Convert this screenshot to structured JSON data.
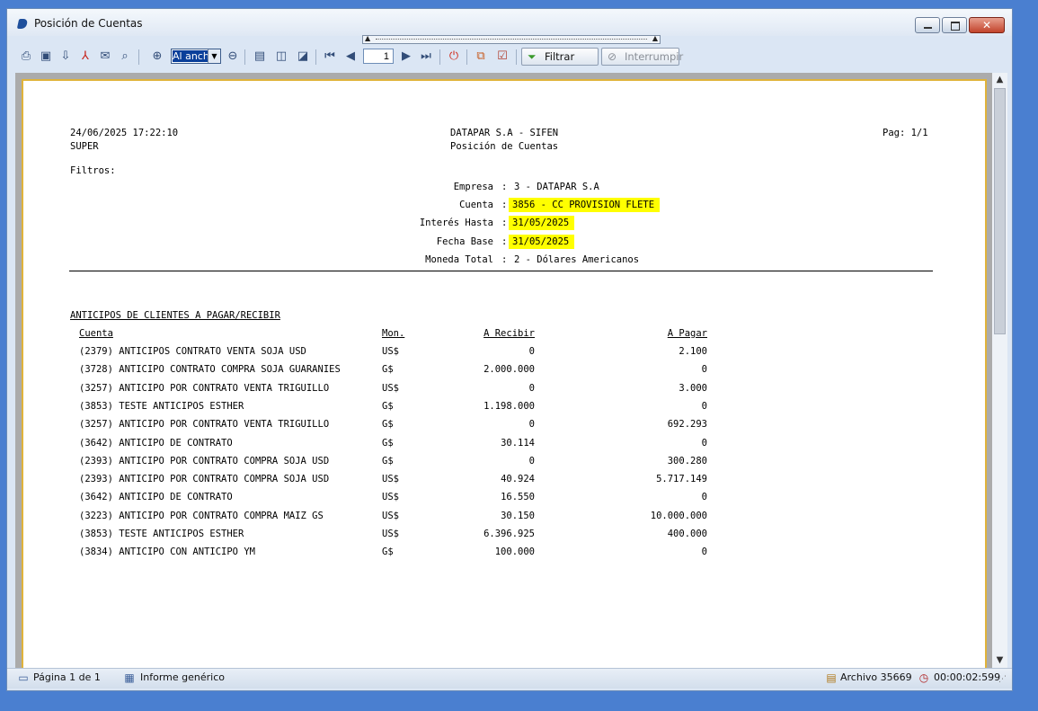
{
  "window": {
    "title": "Posición de Cuentas",
    "close_glyph": "✕"
  },
  "toolbar": {
    "zoom_value": "Al ancho",
    "page_number": "1",
    "filter_label": "Filtrar",
    "interrupt_label": "Interrumpir",
    "icons": [
      "print-icon",
      "save-icon",
      "export-icon",
      "pdf-icon",
      "mail-icon",
      "find-icon",
      "zoom-in-icon",
      "zoom-out-icon",
      "page-setup-icon",
      "single-page-icon",
      "page-zoom-icon",
      "first-page-icon",
      "prev-page-icon",
      "next-page-icon",
      "last-page-icon",
      "stop-icon",
      "copy-icon",
      "settings-icon",
      "filter-icon",
      "interrupt-icon"
    ]
  },
  "report": {
    "datetime": "24/06/2025 17:22:10",
    "user": "SUPER",
    "company_title": "DATAPAR S.A - SIFEN",
    "report_title": "Posición de Cuentas",
    "page": "Pag: 1/1",
    "filters_label": "Filtros:",
    "filters": [
      {
        "label": "Empresa",
        "value": "3 - DATAPAR S.A",
        "highlight": false
      },
      {
        "label": "Cuenta",
        "value": "3856 - CC PROVISION FLETE",
        "highlight": true
      },
      {
        "label": "Interés Hasta",
        "value": "31/05/2025",
        "highlight": true
      },
      {
        "label": "Fecha Base",
        "value": "31/05/2025",
        "highlight": true
      },
      {
        "label": "Moneda Total",
        "value": "2 - Dólares Americanos",
        "highlight": false
      }
    ],
    "section_title": "ANTICIPOS DE CLIENTES A PAGAR/RECIBIR",
    "columns": {
      "account": "Cuenta",
      "currency": "Mon.",
      "receive": "A Recibir",
      "pay": "A Pagar"
    },
    "rows": [
      {
        "account": "(2379) ANTICIPOS CONTRATO VENTA SOJA USD",
        "currency": "US$",
        "receive": "0",
        "pay": "2.100"
      },
      {
        "account": "(3728) ANTICIPO CONTRATO COMPRA SOJA GUARANIES",
        "currency": "G$",
        "receive": "2.000.000",
        "pay": "0"
      },
      {
        "account": "(3257) ANTICIPO POR CONTRATO VENTA TRIGUILLO",
        "currency": "US$",
        "receive": "0",
        "pay": "3.000"
      },
      {
        "account": "(3853) TESTE ANTICIPOS ESTHER",
        "currency": "G$",
        "receive": "1.198.000",
        "pay": "0"
      },
      {
        "account": "(3257) ANTICIPO POR CONTRATO VENTA TRIGUILLO",
        "currency": "G$",
        "receive": "0",
        "pay": "692.293"
      },
      {
        "account": "(3642) ANTICIPO DE CONTRATO",
        "currency": "G$",
        "receive": "30.114",
        "pay": "0"
      },
      {
        "account": "(2393) ANTICIPO POR CONTRATO COMPRA SOJA USD",
        "currency": "G$",
        "receive": "0",
        "pay": "300.280"
      },
      {
        "account": "(2393) ANTICIPO POR CONTRATO COMPRA SOJA USD",
        "currency": "US$",
        "receive": "40.924",
        "pay": "5.717.149"
      },
      {
        "account": "(3642) ANTICIPO DE CONTRATO",
        "currency": "US$",
        "receive": "16.550",
        "pay": "0"
      },
      {
        "account": "(3223) ANTICIPO POR CONTRATO COMPRA MAIZ GS",
        "currency": "US$",
        "receive": "30.150",
        "pay": "10.000.000"
      },
      {
        "account": "(3853) TESTE ANTICIPOS ESTHER",
        "currency": "US$",
        "receive": "6.396.925",
        "pay": "400.000"
      },
      {
        "account": "(3834) ANTICIPO CON ANTICIPO YM",
        "currency": "G$",
        "receive": "100.000",
        "pay": "0"
      }
    ]
  },
  "status": {
    "page_info": "Página 1 de 1",
    "report_type": "Informe genérico",
    "file": "Archivo 35669",
    "elapsed": "00:00:02:599"
  },
  "colors": {
    "highlight": "#ffff00",
    "paper_border": "#e0b33a",
    "desktop": "#4a7fd0"
  }
}
